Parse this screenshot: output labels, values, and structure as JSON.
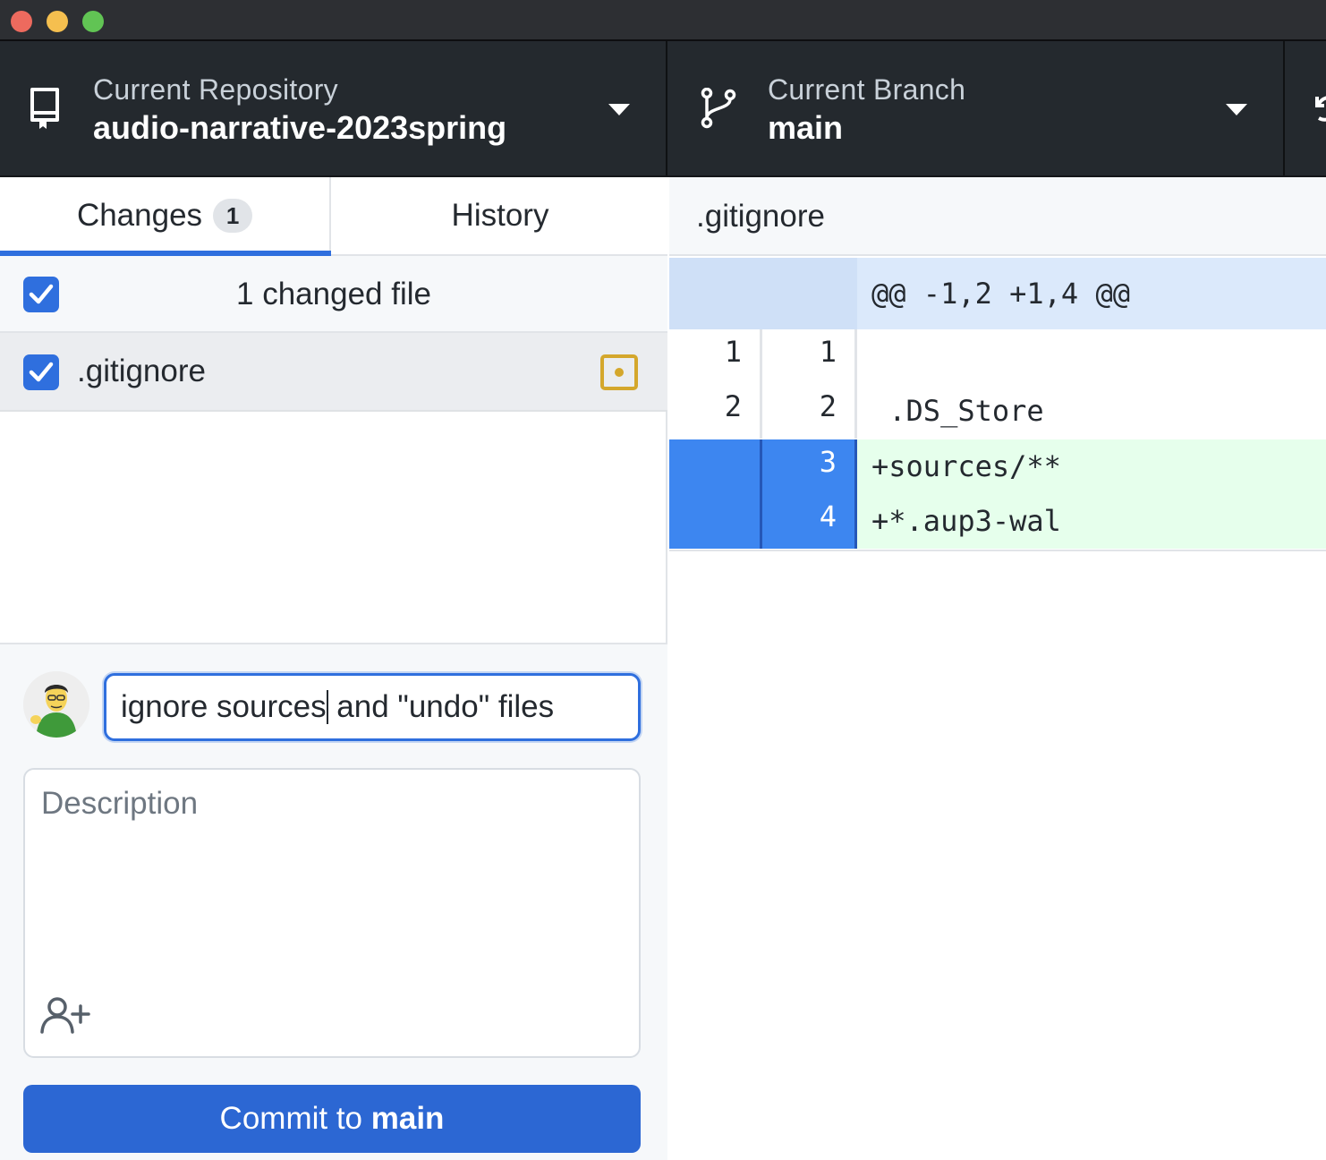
{
  "window": {
    "buttons": [
      "close",
      "minimize",
      "maximize"
    ]
  },
  "toolbar": {
    "repository": {
      "label": "Current Repository",
      "value": "audio-narrative-2023spring",
      "icon": "repo-icon"
    },
    "branch": {
      "label": "Current Branch",
      "value": "main",
      "icon": "git-branch-icon"
    },
    "fetch": {
      "icon": "sync-icon"
    }
  },
  "sidebar": {
    "tabs": [
      {
        "label": "Changes",
        "badge": "1",
        "selected": true
      },
      {
        "label": "History",
        "selected": false
      }
    ],
    "changes_header": {
      "text": "1 changed file",
      "checked": true
    },
    "files": [
      {
        "name": ".gitignore",
        "checked": true,
        "status": "modified"
      }
    ]
  },
  "commit": {
    "summary_before_cursor": "ignore sources",
    "summary_after_cursor": " and \"undo\" files",
    "description_placeholder": "Description",
    "button_prefix": "Commit to ",
    "button_branch": "main"
  },
  "diff": {
    "path": ".gitignore",
    "hunk_header": "@@ -1,2 +1,4 @@",
    "lines": [
      {
        "old": "1",
        "new": "1",
        "text": "",
        "type": "context"
      },
      {
        "old": "2",
        "new": "2",
        "text": " .DS_Store",
        "type": "context"
      },
      {
        "old": "",
        "new": "3",
        "text": "+sources/**",
        "type": "added"
      },
      {
        "old": "",
        "new": "4",
        "text": "+*.aup3-wal",
        "type": "added"
      }
    ]
  },
  "colors": {
    "accent": "#2f6fde",
    "toolbar_bg": "#24292e",
    "added_bg": "#e6ffec",
    "modified": "#d4a72c"
  }
}
